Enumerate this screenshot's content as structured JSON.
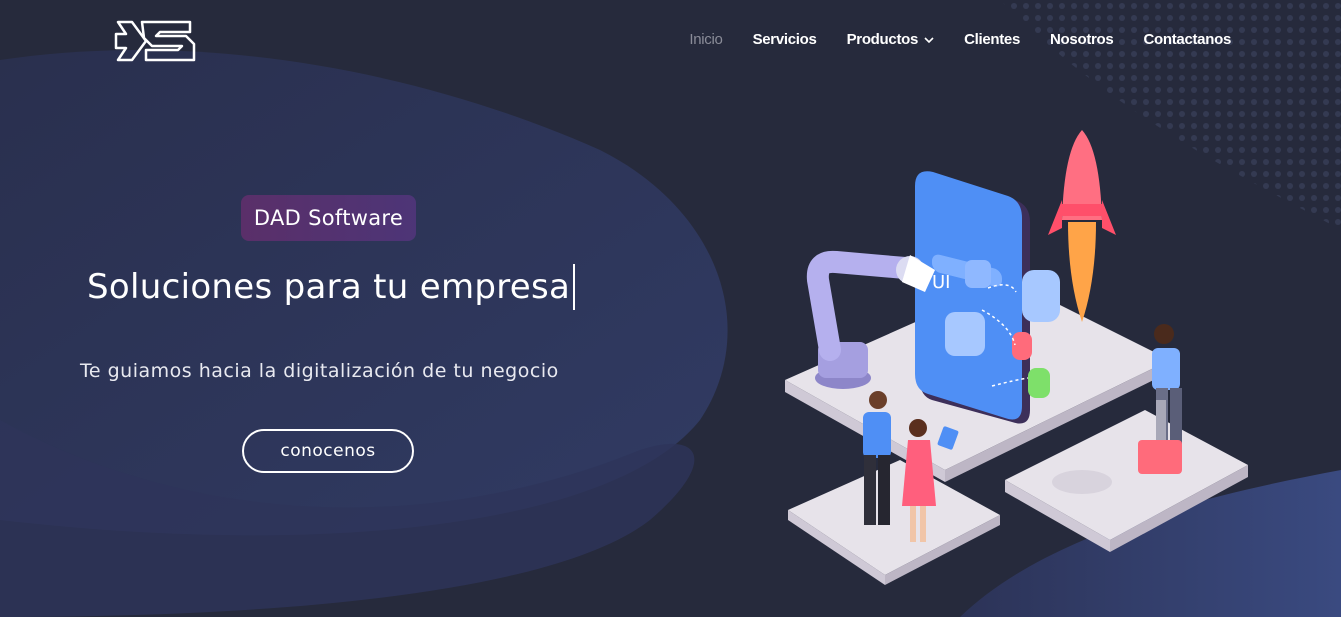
{
  "nav": {
    "items": [
      {
        "label": "Inicio",
        "active": true
      },
      {
        "label": "Servicios"
      },
      {
        "label": "Productos",
        "dropdown": true
      },
      {
        "label": "Clientes"
      },
      {
        "label": "Nosotros"
      },
      {
        "label": "Contactanos"
      }
    ]
  },
  "hero": {
    "badge": "DAD Software",
    "title": "Soluciones para tu empresa",
    "subtitle": "Te guiamos hacia la digitalización de tu negocio",
    "cta_label": "conocenos"
  },
  "illustration": {
    "phone_label": "UI"
  },
  "colors": {
    "background": "#262a3c",
    "wave": "#2f3a63",
    "badge_start": "#5a2f69",
    "badge_end": "#4d3577",
    "phone": "#4f8ff5",
    "rocket": "#ff5f76"
  }
}
